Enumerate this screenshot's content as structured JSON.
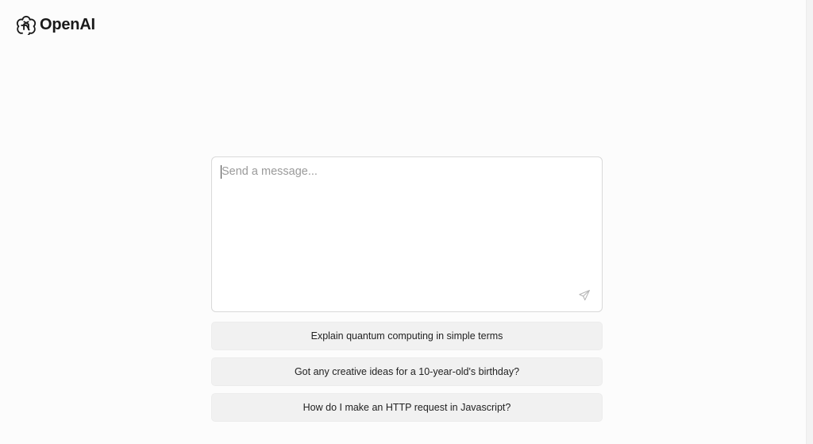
{
  "brand": {
    "name": "OpenAI",
    "logo_icon": "openai-logo-icon"
  },
  "composer": {
    "placeholder": "Send a message...",
    "value": "",
    "send_icon": "send-icon"
  },
  "suggestions": [
    {
      "label": "Explain quantum computing in simple terms"
    },
    {
      "label": "Got any creative ideas for a 10-year-old's birthday?"
    },
    {
      "label": "How do I make an HTTP request in Javascript?"
    }
  ],
  "colors": {
    "background": "#fcfcfc",
    "text": "#1f1f1f",
    "placeholder": "#9a9a9a",
    "suggestion_bg": "#f1f1f1",
    "border": "#d9d9d9"
  }
}
